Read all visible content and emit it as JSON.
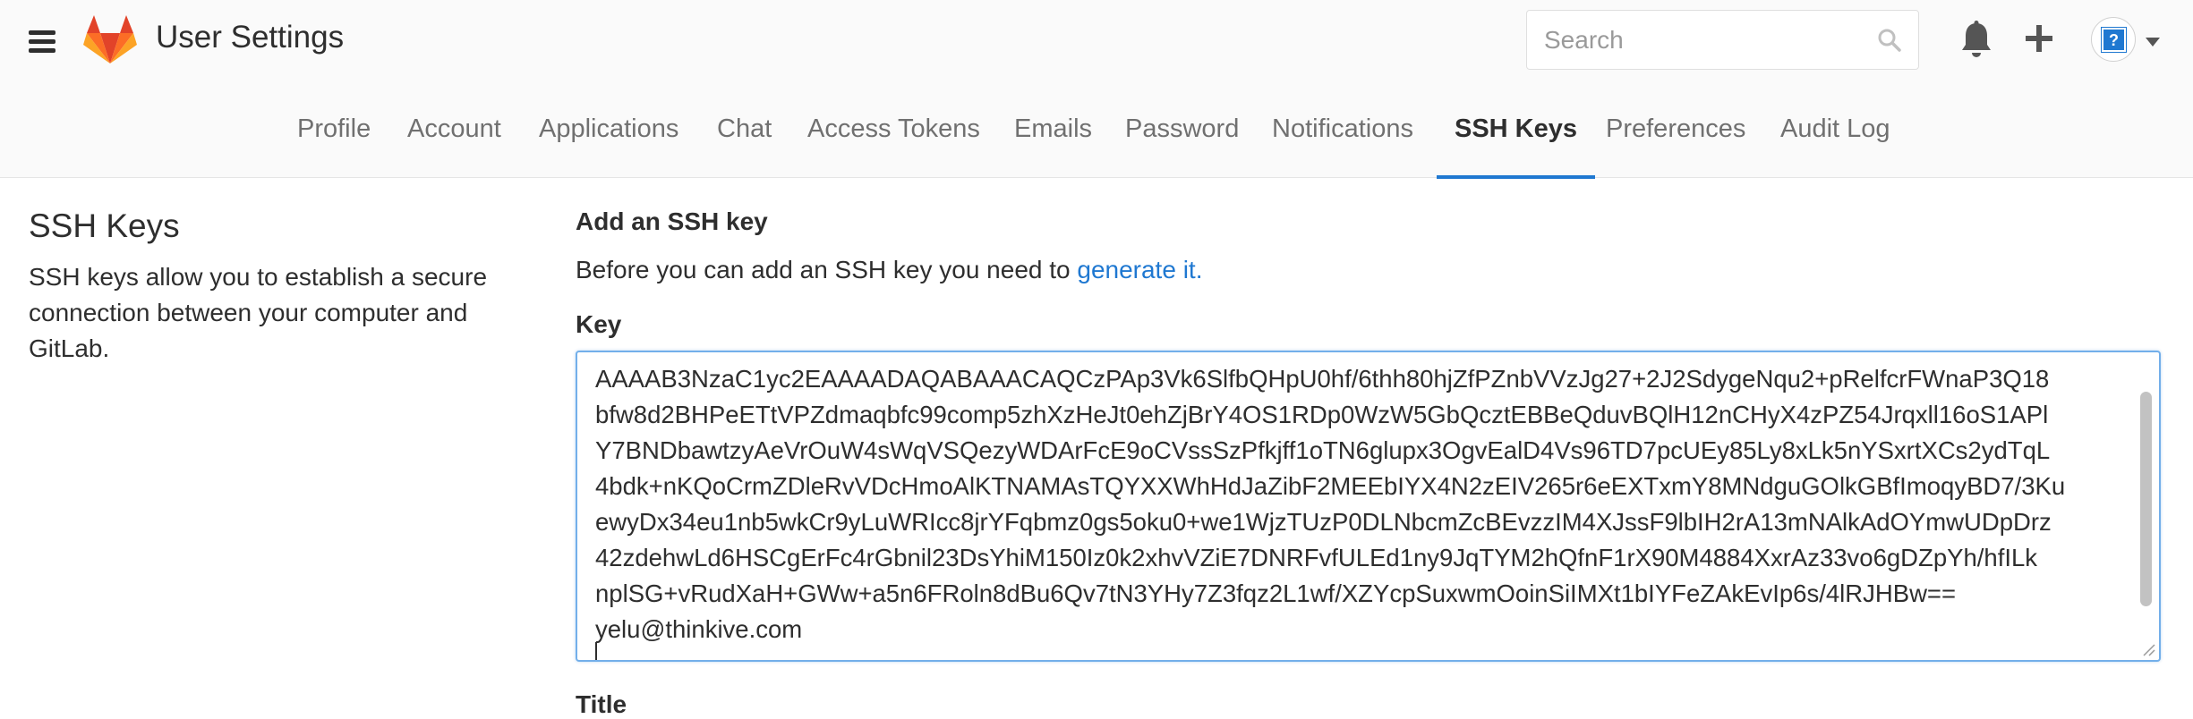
{
  "header": {
    "title": "User Settings",
    "search_placeholder": "Search",
    "avatar_glyph": "?"
  },
  "nav": {
    "tabs": [
      {
        "label": "Profile",
        "active": false
      },
      {
        "label": "Account",
        "active": false
      },
      {
        "label": "Applications",
        "active": false
      },
      {
        "label": "Chat",
        "active": false
      },
      {
        "label": "Access Tokens",
        "active": false
      },
      {
        "label": "Emails",
        "active": false
      },
      {
        "label": "Password",
        "active": false
      },
      {
        "label": "Notifications",
        "active": false
      },
      {
        "label": "SSH Keys",
        "active": true
      },
      {
        "label": "Preferences",
        "active": false
      },
      {
        "label": "Audit Log",
        "active": false
      }
    ]
  },
  "left": {
    "title": "SSH Keys",
    "description": "SSH keys allow you to establish a secure connection between your computer and GitLab."
  },
  "main": {
    "heading": "Add an SSH key",
    "intro_text": "Before you can add an SSH key you need to ",
    "intro_link": "generate it.",
    "key_label": "Key",
    "key_lines": [
      "AAAAB3NzaC1yc2EAAAADAQABAAACAQCzPAp3Vk6SlfbQHpU0hf/6thh80hjZfPZnbVVzJg27+2J2SdygeNqu2+pRelfcrFWnaP3Q18",
      "bfw8d2BHPeETtVPZdmaqbfc99comp5zhXzHeJt0ehZjBrY4OS1RDp0WzW5GbQcztEBBeQduvBQlH12nCHyX4zPZ54Jrqxll16oS1APl",
      "Y7BNDbawtzyAeVrOuW4sWqVSQezyWDArFcE9oCVssSzPfkjff1oTN6glupx3OgvEalD4Vs96TD7pcUEy85Ly8xLk5nYSxrtXCs2ydTqL",
      "4bdk+nKQoCrmZDleRvVDcHmoAlKTNAMAsTQYXXWhHdJaZibF2MEEbIYX4N2zEIV265r6eEXTxmY8MNdguGOlkGBfImoqyBD7/3Ku",
      "ewyDx34eu1nb5wkCr9yLuWRIcc8jrYFqbmz0gs5oku0+we1WjzTUzP0DLNbcmZcBEvzzIM4XJssF9lbIH2rA13mNAlkAdOYmwUDpDrz",
      "42zdehwLd6HSCgErFc4rGbnil23DsYhiM150Iz0k2xhvVZiE7DNRFvfULEd1ny9JqTYM2hQfnF1rX90M4884XxrAz33vo6gDZpYh/hfILk",
      "nplSG+vRudXaH+GWw+a5n6FRoln8dBu6Qv7tN3YHy7Z3fqz2L1wf/XZYcpSuxwmOoinSiIMXt1bIYFeZAkEvIp6s/4lRJHBw==",
      "yelu@thinkive.com"
    ],
    "title_label": "Title"
  },
  "colors": {
    "accent": "#1f78d1",
    "header_bg": "#fafafa",
    "text": "#2e2e2e",
    "muted": "#707070"
  }
}
